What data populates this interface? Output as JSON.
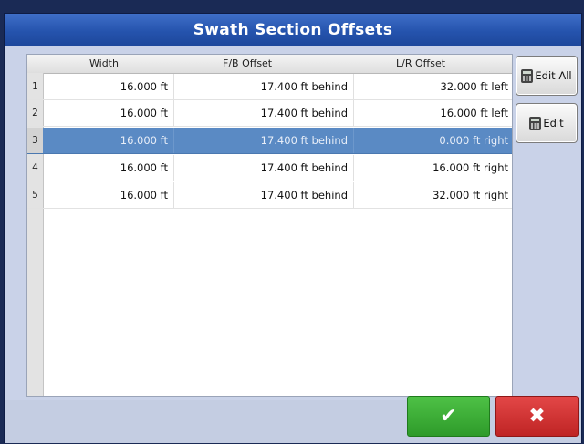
{
  "dialog": {
    "title": "Swath Section Offsets"
  },
  "table": {
    "columns": [
      "Width",
      "F/B Offset",
      "L/R Offset"
    ],
    "rows": [
      {
        "num": "1",
        "width": "16.000 ft",
        "fb": "17.400 ft behind",
        "lr": "32.000 ft left"
      },
      {
        "num": "2",
        "width": "16.000 ft",
        "fb": "17.400 ft behind",
        "lr": "16.000 ft left"
      },
      {
        "num": "3",
        "width": "16.000 ft",
        "fb": "17.400 ft behind",
        "lr": "0.000 ft right"
      },
      {
        "num": "4",
        "width": "16.000 ft",
        "fb": "17.400 ft behind",
        "lr": "16.000 ft right"
      },
      {
        "num": "5",
        "width": "16.000 ft",
        "fb": "17.400 ft behind",
        "lr": "32.000 ft right"
      }
    ],
    "selected_row": "3"
  },
  "buttons": {
    "edit_all": "Edit All",
    "edit": "Edit",
    "ok_symbol": "✔",
    "cancel_symbol": "✖"
  },
  "colors": {
    "title_bar": "#2553ad",
    "selected_row": "#5a8ac4",
    "ok_button": "#3aab34",
    "cancel_button": "#d43535"
  },
  "icons": {
    "edit_all": "calculator-icon",
    "edit": "calculator-icon",
    "ok": "checkmark-icon",
    "cancel": "x-icon"
  }
}
